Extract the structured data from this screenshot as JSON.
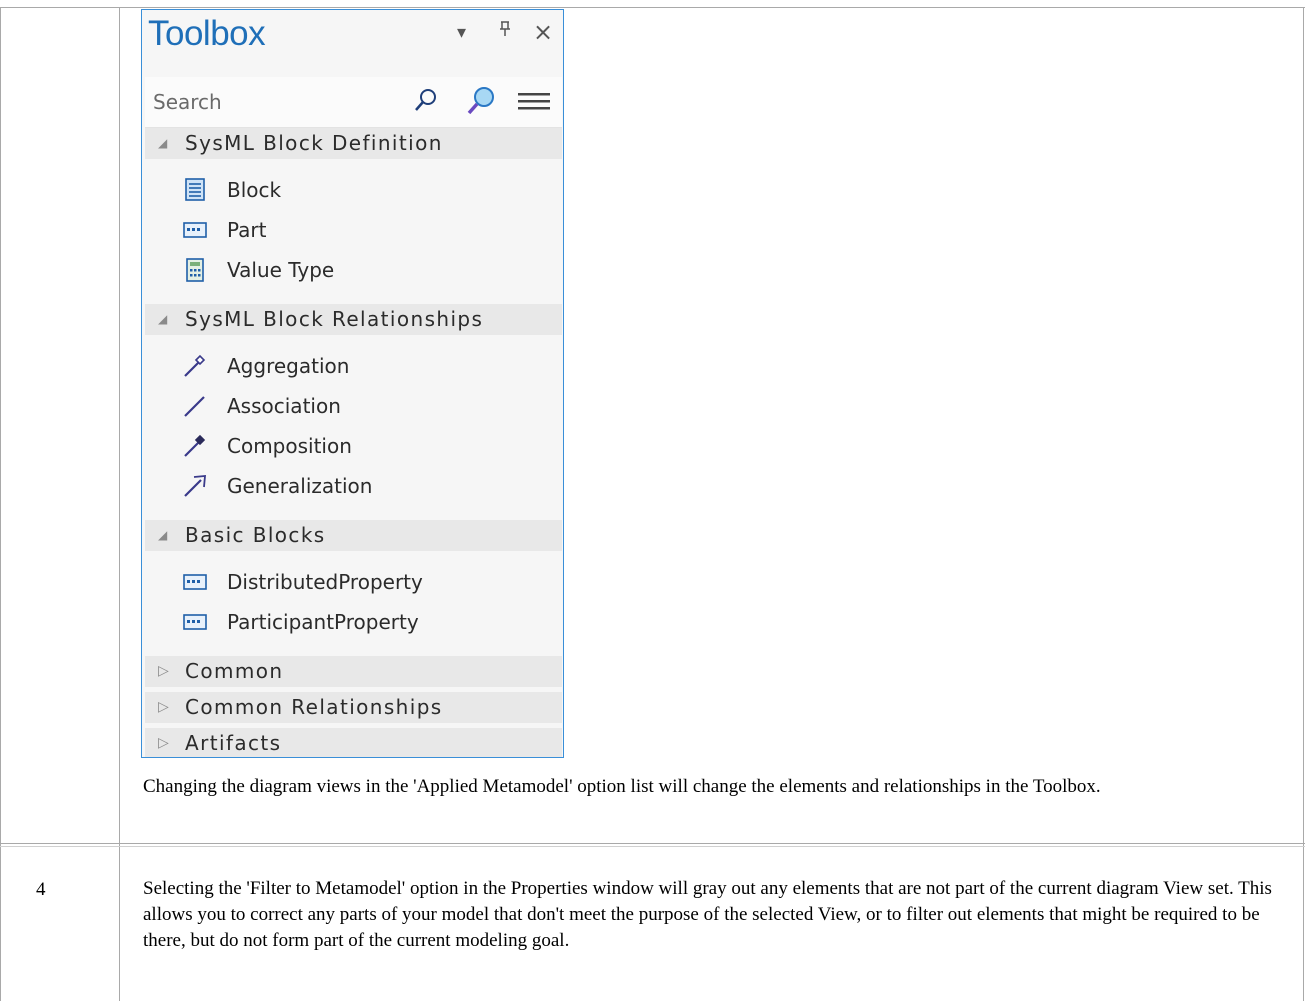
{
  "toolbox": {
    "title": "Toolbox",
    "controls": {
      "dropdown": "▾",
      "pin": "ꟾ",
      "close": "×"
    },
    "search": {
      "placeholder": "Search",
      "value": ""
    },
    "sections": [
      {
        "label": "SysML Block Definition",
        "expanded": true,
        "items": [
          {
            "label": "Block",
            "icon": "block-icon"
          },
          {
            "label": "Part",
            "icon": "part-icon"
          },
          {
            "label": "Value Type",
            "icon": "value-type-icon"
          }
        ]
      },
      {
        "label": "SysML Block Relationships",
        "expanded": true,
        "items": [
          {
            "label": "Aggregation",
            "icon": "aggregation-icon"
          },
          {
            "label": "Association",
            "icon": "association-icon"
          },
          {
            "label": "Composition",
            "icon": "composition-icon"
          },
          {
            "label": "Generalization",
            "icon": "generalization-icon"
          }
        ]
      },
      {
        "label": "Basic Blocks",
        "expanded": true,
        "items": [
          {
            "label": "DistributedProperty",
            "icon": "property-icon"
          },
          {
            "label": "ParticipantProperty",
            "icon": "property-icon"
          }
        ]
      },
      {
        "label": "Common",
        "expanded": false,
        "items": []
      },
      {
        "label": "Common Relationships",
        "expanded": false,
        "items": []
      },
      {
        "label": "Artifacts",
        "expanded": false,
        "items": []
      }
    ]
  },
  "rows": [
    {
      "step": "",
      "text": "Changing the diagram views in the 'Applied Metamodel' option list will change the elements and relationships in the Toolbox."
    },
    {
      "step": "4",
      "text": "Selecting the 'Filter to Metamodel' option in the Properties window will gray out any elements that are not part of the current diagram View set. This allows you to correct any parts of your model that don't meet the purpose of the selected View, or to filter out elements that might be required to be there, but do not form part of the current modeling goal."
    }
  ],
  "colors": {
    "accent": "#1f6fb8",
    "border": "#3a8fd8",
    "table_line": "#a9a9a9"
  }
}
